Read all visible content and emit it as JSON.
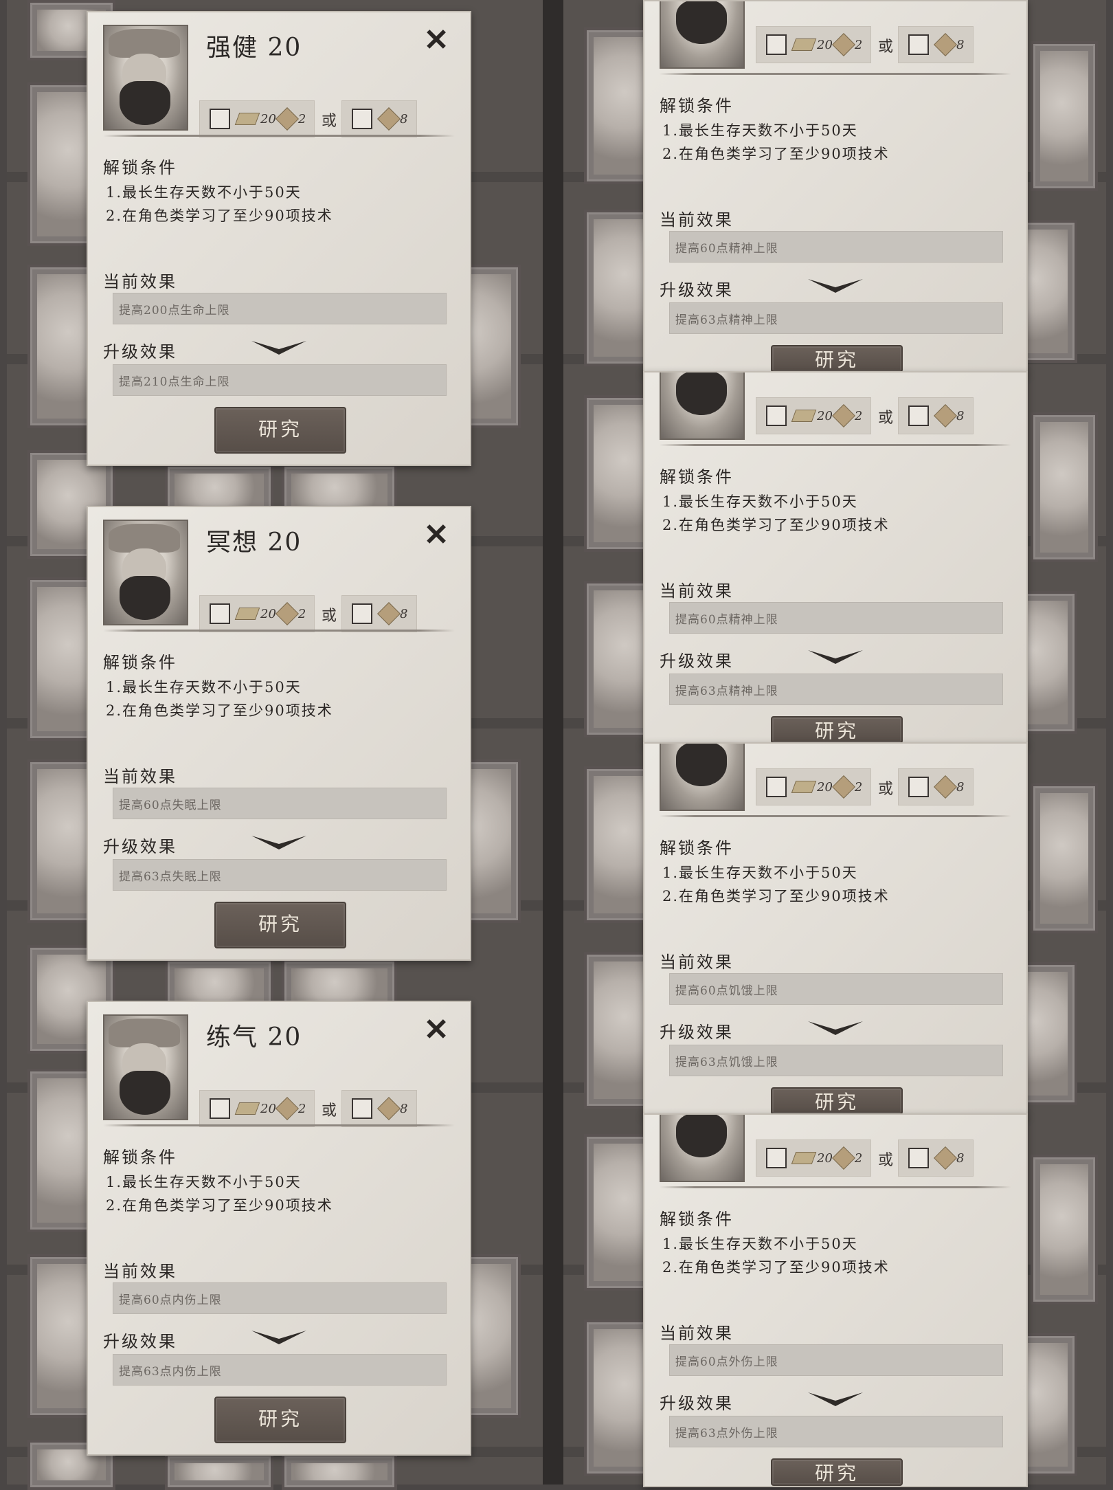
{
  "popups_left": [
    {
      "title": "强健 20",
      "cost_a": "20",
      "cost_a2": "2",
      "or": "或",
      "cost_b": "8",
      "unlock_heading": "解锁条件",
      "conditions": [
        "1.最长生存天数不小于50天",
        "2.在角色类学习了至少90项技术"
      ],
      "current_heading": "当前效果",
      "current_effect": "提高200点生命上限",
      "upgrade_heading": "升级效果",
      "upgrade_effect": "提高210点生命上限",
      "button": "研究"
    },
    {
      "title": "冥想 20",
      "cost_a": "20",
      "cost_a2": "2",
      "or": "或",
      "cost_b": "8",
      "unlock_heading": "解锁条件",
      "conditions": [
        "1.最长生存天数不小于50天",
        "2.在角色类学习了至少90项技术"
      ],
      "current_heading": "当前效果",
      "current_effect": "提高60点失眠上限",
      "upgrade_heading": "升级效果",
      "upgrade_effect": "提高63点失眠上限",
      "button": "研究"
    },
    {
      "title": "练气 20",
      "cost_a": "20",
      "cost_a2": "2",
      "or": "或",
      "cost_b": "8",
      "unlock_heading": "解锁条件",
      "conditions": [
        "1.最长生存天数不小于50天",
        "2.在角色类学习了至少90项技术"
      ],
      "current_heading": "当前效果",
      "current_effect": "提高60点内伤上限",
      "upgrade_heading": "升级效果",
      "upgrade_effect": "提高63点内伤上限",
      "button": "研究"
    }
  ],
  "popups_right": [
    {
      "cost_a": "20",
      "cost_a2": "2",
      "or": "或",
      "cost_b": "8",
      "unlock_heading": "解锁条件",
      "conditions": [
        "1.最长生存天数不小于50天",
        "2.在角色类学习了至少90项技术"
      ],
      "current_heading": "当前效果",
      "current_effect": "提高60点精神上限",
      "upgrade_heading": "升级效果",
      "upgrade_effect": "提高63点精神上限",
      "button": "研究"
    },
    {
      "cost_a": "20",
      "cost_a2": "2",
      "or": "或",
      "cost_b": "8",
      "unlock_heading": "解锁条件",
      "conditions": [
        "1.最长生存天数不小于50天",
        "2.在角色类学习了至少90项技术"
      ],
      "current_heading": "当前效果",
      "current_effect": "提高60点精神上限",
      "upgrade_heading": "升级效果",
      "upgrade_effect": "提高63点精神上限",
      "button": "研究"
    },
    {
      "cost_a": "20",
      "cost_a2": "2",
      "or": "或",
      "cost_b": "8",
      "unlock_heading": "解锁条件",
      "conditions": [
        "1.最长生存天数不小于50天",
        "2.在角色类学习了至少90项技术"
      ],
      "current_heading": "当前效果",
      "current_effect": "提高60点饥饿上限",
      "upgrade_heading": "升级效果",
      "upgrade_effect": "提高63点饥饿上限",
      "button": "研究"
    },
    {
      "cost_a": "20",
      "cost_a2": "2",
      "or": "或",
      "cost_b": "8",
      "unlock_heading": "解锁条件",
      "conditions": [
        "1.最长生存天数不小于50天",
        "2.在角色类学习了至少90项技术"
      ],
      "current_heading": "当前效果",
      "current_effect": "提高60点外伤上限",
      "upgrade_heading": "升级效果",
      "upgrade_effect": "提高63点外伤上限",
      "button": "研究"
    }
  ],
  "colors": {
    "paper": "#e6e2db",
    "button": "#5f5650",
    "background": "#4a4645"
  }
}
